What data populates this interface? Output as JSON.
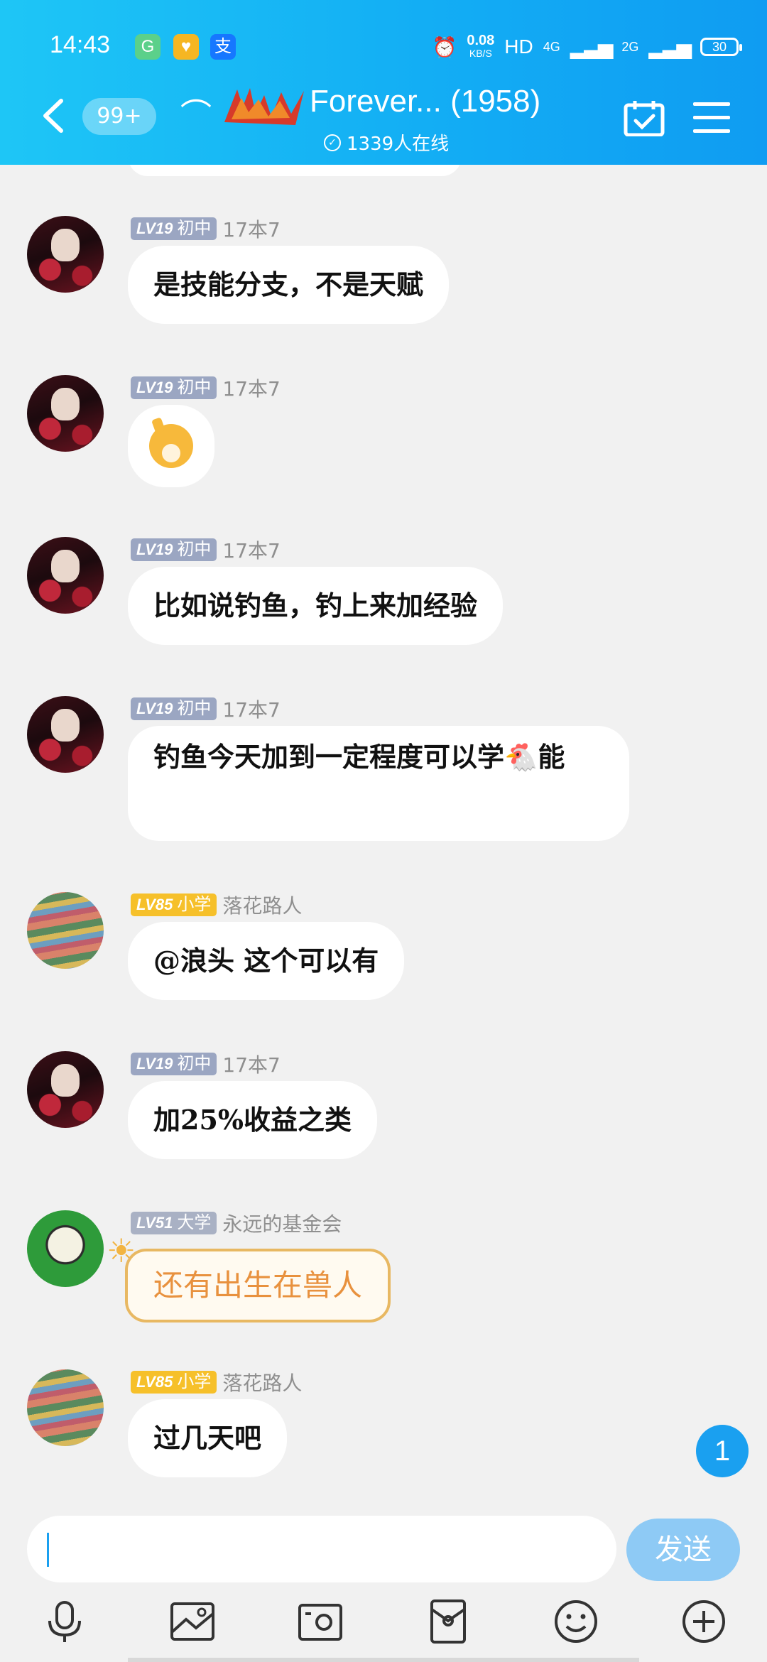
{
  "status_bar": {
    "time": "14:43",
    "apps": [
      "G",
      "♥",
      "支"
    ],
    "net_speed": "0.08",
    "net_unit": "KB/S",
    "hd": "HD",
    "sig1": "4G",
    "sig2": "2G",
    "battery": "30"
  },
  "header": {
    "badge": "99+",
    "title": "Forever... (1958)",
    "online": "1339人在线"
  },
  "messages": [
    {
      "level": "LV19",
      "rank": "初中",
      "nick": "17本7",
      "text": "是技能分支，不是天赋"
    },
    {
      "level": "LV19",
      "rank": "初中",
      "nick": "17本7",
      "text": ""
    },
    {
      "level": "LV19",
      "rank": "初中",
      "nick": "17本7",
      "text": "比如说钓鱼，钓上来加经验"
    },
    {
      "level": "LV19",
      "rank": "初中",
      "nick": "17本7",
      "text": "钓鱼今天加到一定程度可以学🐔能"
    },
    {
      "level": "LV85",
      "rank": "小学",
      "nick": "落花路人",
      "text": "@浪头 这个可以有"
    },
    {
      "level": "LV19",
      "rank": "初中",
      "nick": "17本7",
      "text": "加25%收益之类"
    },
    {
      "level": "LV51",
      "rank": "大学",
      "nick": "永远的基金会",
      "text": "还有出生在兽人"
    },
    {
      "level": "LV85",
      "rank": "小学",
      "nick": "落花路人",
      "text": "过几天吧"
    }
  ],
  "new_message_count": "1",
  "input": {
    "placeholder": "",
    "send_label": "发送"
  },
  "icons": [
    "microphone-icon",
    "image-icon",
    "camera-icon",
    "red-packet-icon",
    "emoji-icon",
    "plus-icon"
  ],
  "colors": {
    "header": "#13aef4",
    "send": "#8ecaf5",
    "level_gray": "#a9b1c4",
    "level_yellow": "#f6c02a"
  }
}
